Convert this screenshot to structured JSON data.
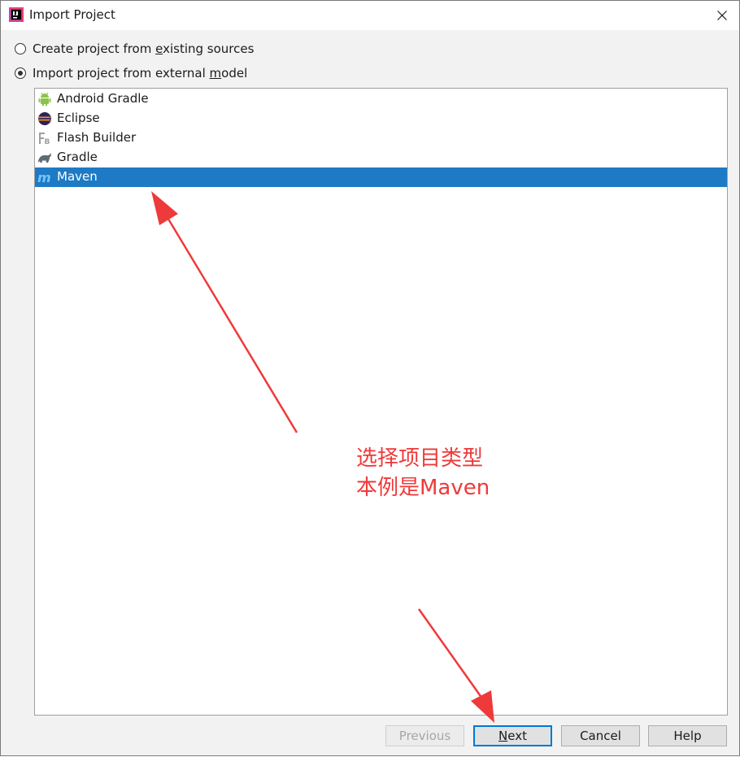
{
  "window": {
    "title": "Import Project",
    "app_icon": "intellij-icon",
    "close_icon": "close-icon"
  },
  "options": {
    "create_from_sources": {
      "label_pre": "Create project from ",
      "label_mnemonic": "e",
      "label_post": "xisting sources",
      "checked": false
    },
    "import_from_model": {
      "label_pre": "Import project from external ",
      "label_mnemonic": "m",
      "label_post": "odel",
      "checked": true
    }
  },
  "models": [
    {
      "label": "Android Gradle",
      "icon": "android-icon",
      "selected": false
    },
    {
      "label": "Eclipse",
      "icon": "eclipse-icon",
      "selected": false
    },
    {
      "label": "Flash Builder",
      "icon": "flash-builder-icon",
      "selected": false
    },
    {
      "label": "Gradle",
      "icon": "gradle-icon",
      "selected": false
    },
    {
      "label": "Maven",
      "icon": "maven-icon",
      "selected": true
    }
  ],
  "annotation": {
    "line1": "选择项目类型",
    "line2": "本例是Maven",
    "color": "#ee3a3a"
  },
  "buttons": {
    "previous": {
      "label": "Previous",
      "enabled": false
    },
    "next": {
      "label_mnemonic": "N",
      "label_post": "ext",
      "enabled": true
    },
    "cancel": {
      "label": "Cancel",
      "enabled": true
    },
    "help": {
      "label": "Help",
      "enabled": true
    }
  },
  "colors": {
    "selection": "#1e7ac4",
    "default_button_border": "#0078d7"
  }
}
